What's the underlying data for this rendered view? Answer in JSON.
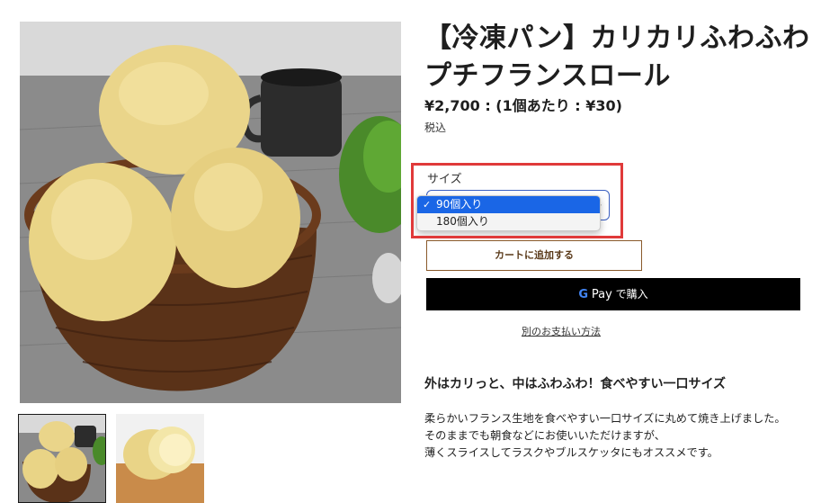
{
  "product": {
    "title_line1": "【冷凍パン】カリカリふわふわ",
    "title_line2": "プチフランスロール",
    "price": "¥2,700 : (1個あたり : ¥30)",
    "tax_note": "税込"
  },
  "variant": {
    "label": "サイズ",
    "options": [
      "90個入り",
      "180個入り"
    ],
    "selected": "90個入り",
    "check_mark": "✓",
    "chevron": "⌄"
  },
  "actions": {
    "add_to_cart": "カートに追加する",
    "gpay_g": "G",
    "gpay_pay": "Pay",
    "gpay_suffix": "で購入",
    "more_payment": "別のお支払い方法"
  },
  "description": {
    "heading": "外はカリっと、中はふわふわ！食べやすい一口サイズ",
    "lines": [
      "柔らかいフランス生地を食べやすい一口サイズに丸めて焼き上げました。",
      "そのままでも朝食などにお使いいただけますが、",
      "薄くスライスしてラスクやブルスケッタにもオススメです。"
    ]
  },
  "colors": {
    "highlight": "#e03a3a",
    "dropdown_selected": "#1a66e6",
    "cart_border": "#8a5a2b"
  }
}
